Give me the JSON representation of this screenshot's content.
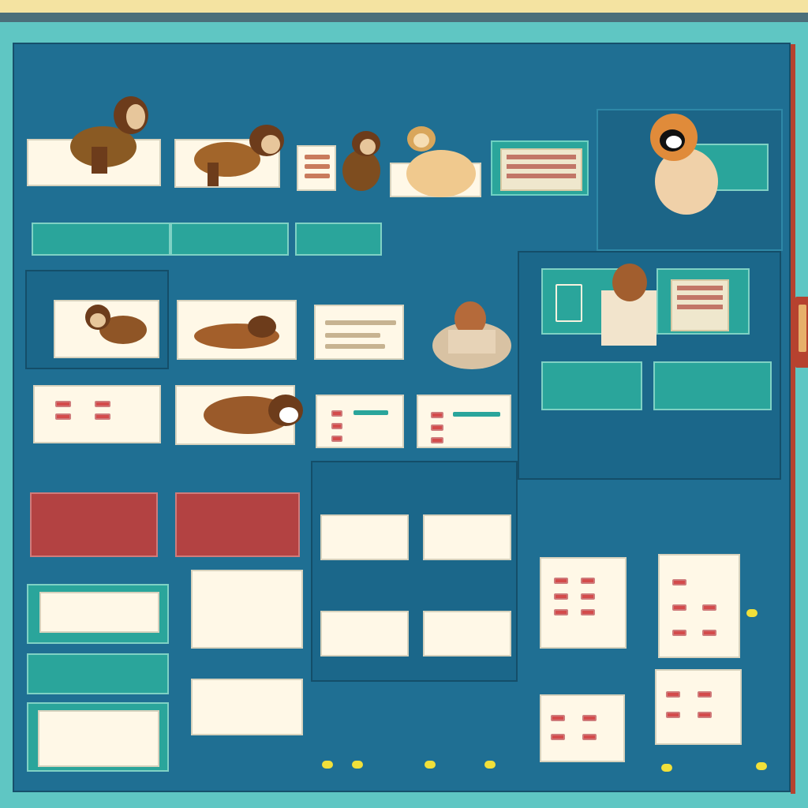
{
  "header": {
    "logo_text": "",
    "title_left": "",
    "title_right": ""
  },
  "colors": {
    "board": "#1f6f93",
    "board_border": "#16506b",
    "teal": "#2aa59b",
    "red": "#b34242",
    "cream": "#fff8e7",
    "accent_yellow": "#f1e03a",
    "frame_red": "#b6422f"
  },
  "icons": {
    "dog_icon_1": "dog-icon",
    "dog_icon_2": "dog-icon",
    "dog_icon_3": "dog-icon",
    "dog_icon_4": "dog-icon",
    "person_icon": "person-icon",
    "clip_icon": "clip-icon"
  }
}
